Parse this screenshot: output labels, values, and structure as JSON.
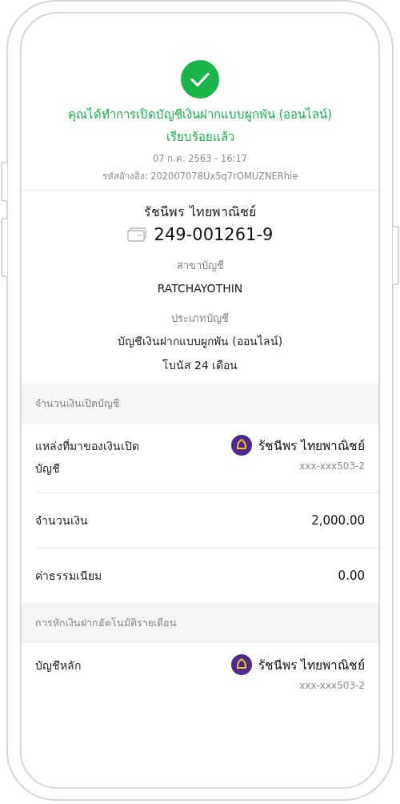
{
  "result": {
    "title": "คุณได้ทำการเปิดบัญชีเงินฝากแบบผูกพัน (ออนไลน์) เรียบร้อยแล้ว",
    "date": "07 ก.ค. 2563 - 16:17",
    "reference": "รหัสอ้างอิง: 202007078Ux5q7rOMUZNERhie"
  },
  "account": {
    "holder": "รัชนีพร ไทยพาณิชย์",
    "number": "249-001261-9",
    "fields": [
      {
        "label": "สาขาบัญชี",
        "lines": [
          "RATCHAYOTHIN"
        ]
      },
      {
        "label": "ประเภทบัญชี",
        "lines": [
          "บัญชีเงินฝากแบบผูกพัน (ออนไลน์)",
          "โบนัส 24 เดือน"
        ]
      }
    ]
  },
  "sections": [
    {
      "header": "จำนวนเงินเปิดบัญชี",
      "rows": [
        {
          "kind": "bank",
          "label": "แหล่งที่มาของเงินเปิดบัญชี",
          "name": "รัชนีพร ไทยพาณิชย์",
          "account": "xxx-xxx503-2"
        },
        {
          "kind": "value",
          "label": "จำนวนเงิน",
          "value": "2,000.00"
        },
        {
          "kind": "value",
          "label": "ค่าธรรมเนียม",
          "value": "0.00"
        }
      ]
    },
    {
      "header": "การหักเงินฝากอัตโนมัติรายเดือน",
      "rows": [
        {
          "kind": "bank",
          "label": "บัญชีหลัก",
          "name": "รัชนีพร ไทยพาณิชย์",
          "account": "xxx-xxx503-2"
        }
      ]
    }
  ]
}
